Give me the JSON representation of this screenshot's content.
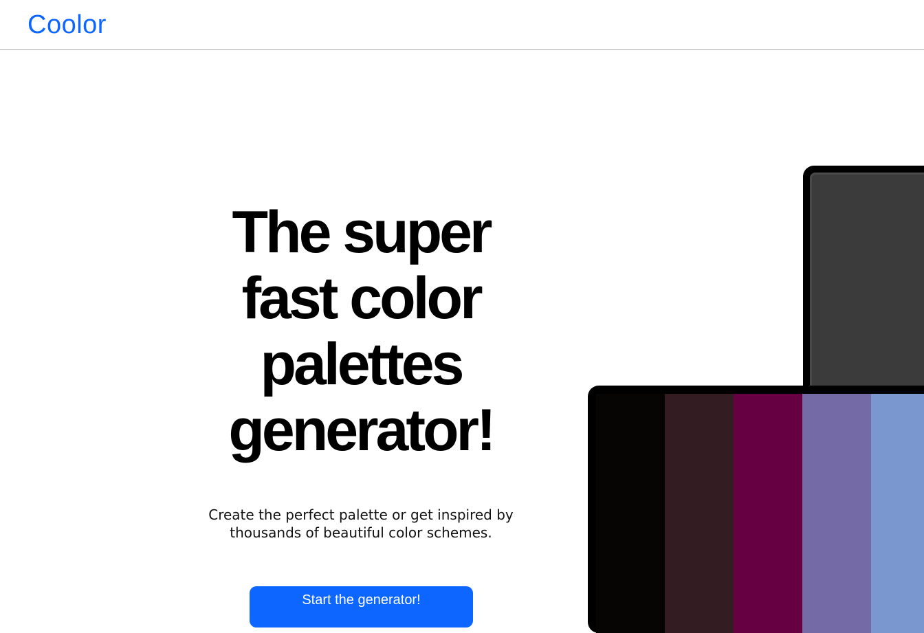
{
  "navbar": {
    "logo_text": "Coolor"
  },
  "hero": {
    "title": "The super fast color palettes generator!",
    "subtitle": "Create the perfect palette or get inspired by\nthousands of beautiful color schemes.",
    "cta_label": "Start the generator!"
  },
  "colors": {
    "accent": "#0d66ff"
  },
  "palette_preview": {
    "swatches": [
      {
        "color": "#060504"
      },
      {
        "color": "#341c23"
      },
      {
        "color": "#660042"
      },
      {
        "color": "#746ba6"
      },
      {
        "color": "#7a97cf"
      }
    ],
    "back_screen_color": "#3b3b3b"
  }
}
